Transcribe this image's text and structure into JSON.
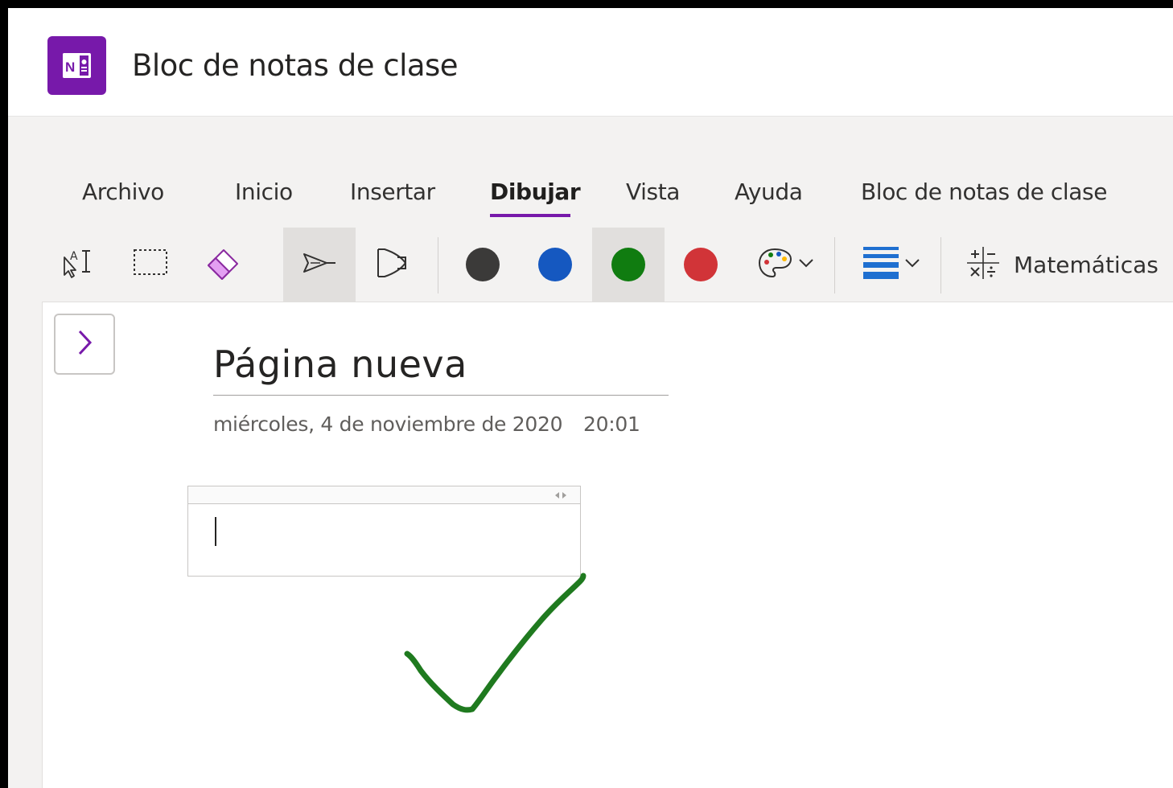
{
  "app": {
    "title": "Bloc de notas de clase",
    "logo_icon": "onenote-logo-icon",
    "brand_color": "#7719aa"
  },
  "tabs": [
    {
      "label": "Archivo",
      "active": false
    },
    {
      "label": "Inicio",
      "active": false
    },
    {
      "label": "Insertar",
      "active": false
    },
    {
      "label": "Dibujar",
      "active": true
    },
    {
      "label": "Vista",
      "active": false
    },
    {
      "label": "Ayuda",
      "active": false
    },
    {
      "label": "Bloc de notas de clase",
      "active": false
    }
  ],
  "ribbon": {
    "tools": [
      {
        "icon": "type-select-icon",
        "selected": false
      },
      {
        "icon": "lasso-select-icon",
        "selected": false
      },
      {
        "icon": "eraser-icon",
        "selected": false
      },
      {
        "icon": "pen-icon",
        "selected": true
      },
      {
        "icon": "highlighter-icon",
        "selected": false
      }
    ],
    "colors": [
      {
        "name": "black",
        "hex": "#3b3a39",
        "selected": false
      },
      {
        "name": "blue",
        "hex": "#1558c0",
        "selected": false
      },
      {
        "name": "green",
        "hex": "#107c10",
        "selected": true
      },
      {
        "name": "red",
        "hex": "#d13438",
        "selected": false
      }
    ],
    "extra_tools": [
      "palette-icon",
      "stroke-thickness-icon",
      "math-icon"
    ],
    "math_label": "Matemáticas"
  },
  "page": {
    "title": "Página nueva",
    "date": "miércoles, 4 de noviembre de 2020",
    "time": "20:01"
  },
  "ink": {
    "color": "#1f7a1f",
    "shape": "checkmark"
  }
}
